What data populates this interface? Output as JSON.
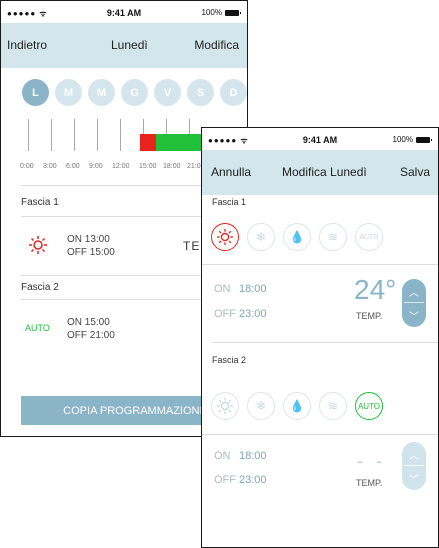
{
  "status_bar": {
    "signal": "●●●●● ᯤ",
    "time": "9:41 AM",
    "battery": "100%"
  },
  "schedule_screen": {
    "nav": {
      "back": "Indietro",
      "title": "Lunedì",
      "edit": "Modifica"
    },
    "days": [
      "L",
      "M",
      "M",
      "G",
      "V",
      "S",
      "D"
    ],
    "active_day": "L",
    "hours": [
      "0:00",
      "3:00",
      "6:00",
      "9:00",
      "12:00",
      "15:00",
      "18:00",
      "21:00"
    ],
    "slot1": {
      "label": "Fascia 1",
      "mode_icon": "sun-icon",
      "on": "ON 13:00",
      "off": "OFF 15:00",
      "temp_cut": "TEM"
    },
    "slot2": {
      "label": "Fascia 2",
      "mode_label": "AUTO",
      "on": "ON 15:00",
      "off": "OFF 21:00"
    },
    "copy_button": "COPIA PROGRAMMAZIONE",
    "colors": {
      "heat": "#e8231d",
      "auto": "#21c03a"
    }
  },
  "edit_screen": {
    "nav": {
      "cancel": "Annulla",
      "title": "Modifica Lunedì",
      "save": "Salva"
    },
    "slot1": {
      "label": "Fascia 1",
      "modes": [
        "sun-icon",
        "snowflake-icon",
        "drops-icon",
        "wind-icon",
        "AUTO"
      ],
      "selected": "sun-icon",
      "on_label": "ON",
      "on_time": "18:00",
      "off_label": "OFF",
      "off_time": "23:00",
      "temp": "24°",
      "temp_label": "TEMP."
    },
    "slot2": {
      "label": "Fascia 2",
      "modes": [
        "sun-icon",
        "snowflake-icon",
        "drops-icon",
        "wind-icon",
        "AUTO"
      ],
      "selected": "AUTO",
      "on_label": "ON",
      "on_time": "18:00",
      "off_label": "OFF",
      "off_time": "23:00",
      "temp": "- -",
      "temp_label": "TEMP."
    }
  }
}
